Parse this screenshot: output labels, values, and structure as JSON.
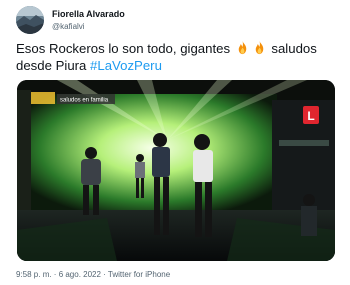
{
  "user": {
    "name": "Fiorella Alvarado",
    "handle": "@kafialvi"
  },
  "tweet": {
    "text": "Esos Rockeros lo son todo, gigantes ",
    "emoji": [
      "fire",
      "fire"
    ],
    "text_after": " saludos desde Piura ",
    "hashtag": "#LaVozPeru"
  },
  "media": {
    "tv_logo": "L",
    "overlay_text": "saludos en familia"
  },
  "meta": {
    "time": "9:58 p. m.",
    "sep": " · ",
    "date": "6 ago. 2022",
    "client": "Twitter for iPhone"
  },
  "colors": {
    "hashtag": "#1d9bf0",
    "secondary": "#536471",
    "stage_green": "#2fd34f",
    "tv_logo": "#e0262f"
  }
}
